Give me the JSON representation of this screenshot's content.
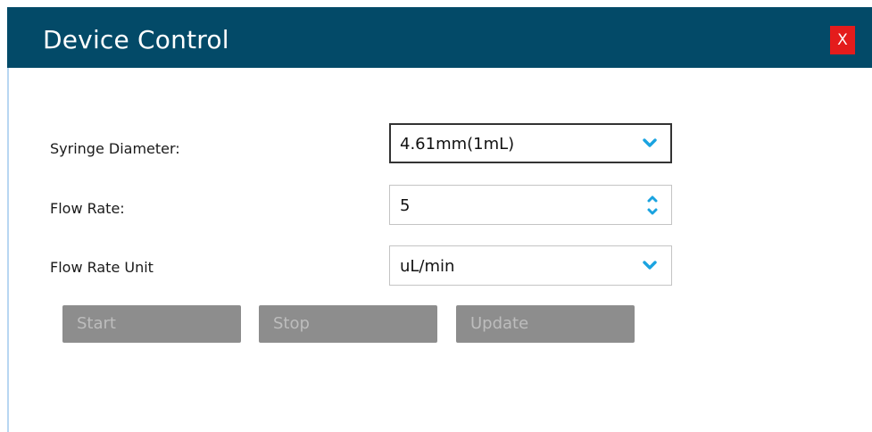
{
  "window": {
    "title": "Device Control",
    "close_label": "X"
  },
  "form": {
    "syringe_diameter": {
      "label": "Syringe Diameter:",
      "value": "4.61mm(1mL)",
      "icon": "chevron-down-icon"
    },
    "flow_rate": {
      "label": "Flow Rate:",
      "value": "5",
      "icon": "spinner-arrows-icon"
    },
    "flow_rate_unit": {
      "label": "Flow Rate Unit",
      "value": "uL/min",
      "icon": "chevron-down-icon"
    }
  },
  "buttons": {
    "start": "Start",
    "stop": "Stop",
    "update": "Update",
    "state": "disabled"
  },
  "colors": {
    "titlebar": "#034a68",
    "close": "#e41c1c",
    "accent_icon": "#1aa3e0",
    "button_disabled": "#8d8d8d"
  }
}
